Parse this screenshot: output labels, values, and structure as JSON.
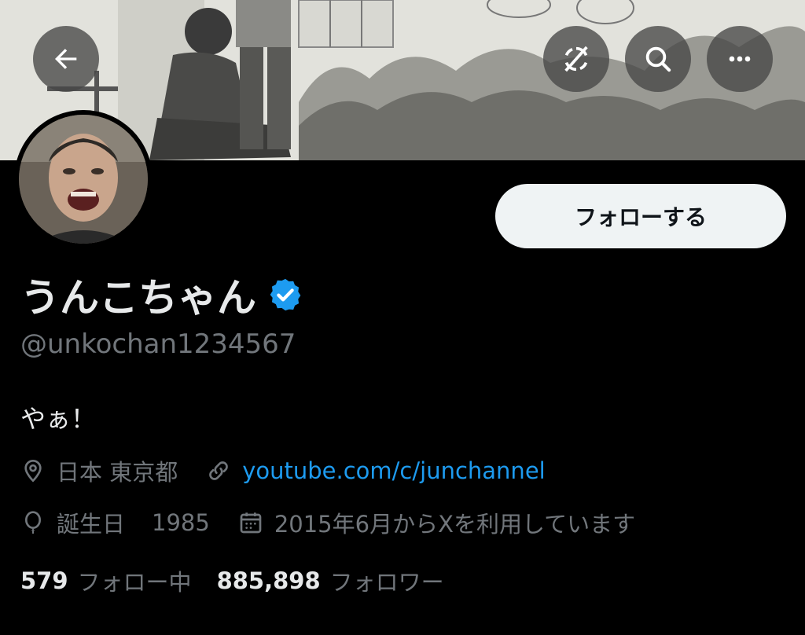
{
  "header": {
    "back_icon": "arrow-left-icon",
    "sync_icon": "sync-off-icon",
    "search_icon": "search-icon",
    "more_icon": "more-horizontal-icon"
  },
  "profile": {
    "display_name": "うんこちゃん",
    "verified": true,
    "handle": "@unkochan1234567",
    "bio": "やぁ！",
    "location": "日本 東京都",
    "website": "youtube.com/c/junchannel",
    "birthday_label": "誕生日",
    "birthday_value": "1985",
    "joined": "2015年6月からXを利用しています",
    "follow_button": "フォローする"
  },
  "stats": {
    "following_count": "579",
    "following_label": "フォロー中",
    "followers_count": "885,898",
    "followers_label": "フォロワー"
  },
  "colors": {
    "background": "#000000",
    "text": "#e7e9ea",
    "muted": "#71767b",
    "link": "#1d9bf0",
    "verified": "#1d9bf0",
    "button_bg": "#eff3f4"
  }
}
